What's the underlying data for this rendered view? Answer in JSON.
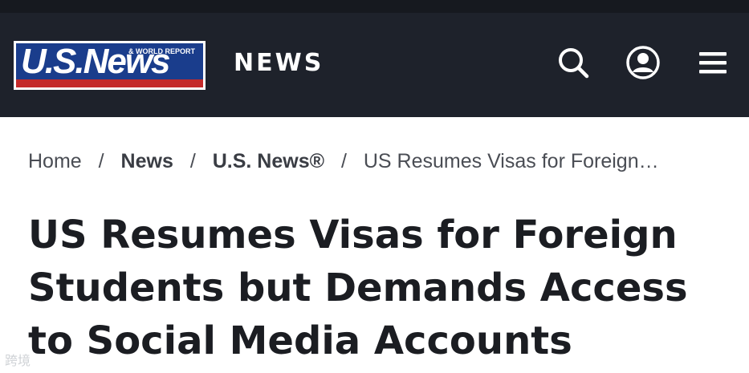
{
  "header": {
    "logo": {
      "wordmark": "U.S.News",
      "subtitle": "& WORLD REPORT"
    },
    "section_label": "NEWS",
    "icons": [
      "search-icon",
      "account-icon",
      "menu-icon"
    ]
  },
  "breadcrumb": {
    "items": [
      "Home",
      "News",
      "U.S. News®",
      "US Resumes Visas for Foreign…"
    ],
    "separator": "/"
  },
  "article": {
    "headline_lines": [
      "US Resumes Visas for Foreign",
      "Students but Demands Access",
      "to Social Media Accounts"
    ]
  },
  "watermark": {
    "text": "跨境"
  },
  "colors": {
    "header_bg": "#1e222b",
    "logo_blue": "#1a3d8c",
    "logo_red": "#c42a2a",
    "headline": "#1b1d22"
  }
}
